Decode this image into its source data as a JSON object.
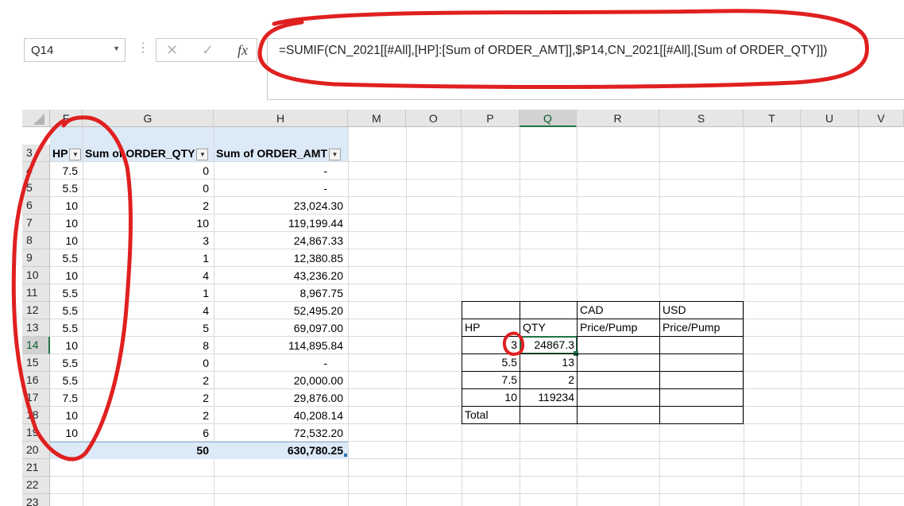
{
  "formula_bar": {
    "name_box": "Q14",
    "formula": "=SUMIF(CN_2021[[#All],[HP]:[Sum of ORDER_AMT]],$P14,CN_2021[[#All],[Sum of ORDER_QTY]])"
  },
  "columns": [
    "F",
    "G",
    "H",
    "M",
    "O",
    "P",
    "Q",
    "R",
    "S",
    "T",
    "U",
    "V"
  ],
  "rows": [
    "3",
    "4",
    "5",
    "6",
    "7",
    "8",
    "9",
    "10",
    "11",
    "12",
    "13",
    "14",
    "15",
    "16",
    "17",
    "18",
    "19",
    "20",
    "21",
    "22",
    "23"
  ],
  "pivot": {
    "headers": [
      "HP",
      "Sum of ORDER_QTY",
      "Sum of ORDER_AMT"
    ],
    "rows": [
      [
        "7.5",
        "0",
        "-"
      ],
      [
        "5.5",
        "0",
        "-"
      ],
      [
        "10",
        "2",
        "23,024.30"
      ],
      [
        "10",
        "10",
        "119,199.44"
      ],
      [
        "10",
        "3",
        "24,867.33"
      ],
      [
        "5.5",
        "1",
        "12,380.85"
      ],
      [
        "10",
        "4",
        "43,236.20"
      ],
      [
        "5.5",
        "1",
        "8,967.75"
      ],
      [
        "5.5",
        "4",
        "52,495.20"
      ],
      [
        "5.5",
        "5",
        "69,097.00"
      ],
      [
        "10",
        "8",
        "114,895.84"
      ],
      [
        "5.5",
        "0",
        "-"
      ],
      [
        "5.5",
        "2",
        "20,000.00"
      ],
      [
        "7.5",
        "2",
        "29,876.00"
      ],
      [
        "10",
        "2",
        "40,208.14"
      ],
      [
        "10",
        "6",
        "72,532.20"
      ]
    ],
    "total": [
      "",
      "50",
      "630,780.25"
    ]
  },
  "side_table": {
    "row12": [
      "",
      "",
      "CAD",
      "USD"
    ],
    "row13": [
      "HP",
      "QTY",
      "Price/Pump",
      "Price/Pump"
    ],
    "row14": [
      "3",
      "24867.3",
      "",
      ""
    ],
    "row15": [
      "5.5",
      "13",
      "",
      ""
    ],
    "row16": [
      "7.5",
      "2",
      "",
      ""
    ],
    "row17": [
      "10",
      "119234",
      "",
      ""
    ],
    "row18": [
      "Total",
      "",
      "",
      ""
    ]
  },
  "colors": {
    "annotation": "#e02020",
    "accent": "#217346",
    "pivot_header": "#dce9f6"
  }
}
